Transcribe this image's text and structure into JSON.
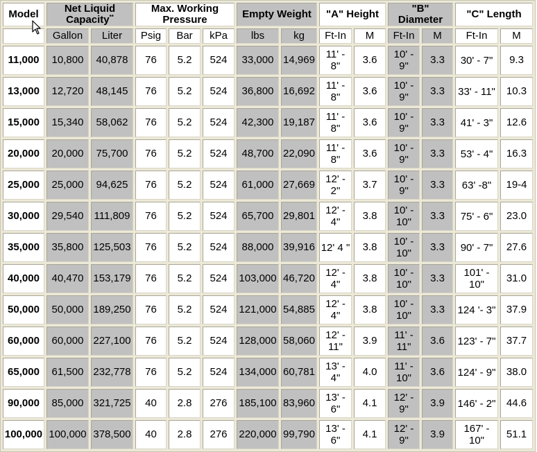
{
  "header": {
    "model": "Model",
    "net_liquid_capacity": "Net Liquid Capacity",
    "net_liquid_capacity_note": "**",
    "max_working_pressure": "Max. Working Pressure",
    "empty_weight": "Empty Weight",
    "a_height": "\"A\" Height",
    "b_diameter": "\"B\" Diameter",
    "c_length": "\"C\" Length"
  },
  "subheader": {
    "gallon": "Gallon",
    "liter": "Liter",
    "psig": "Psig",
    "bar": "Bar",
    "kpa": "kPa",
    "lbs": "lbs",
    "kg": "kg",
    "a_ftin": "Ft-In",
    "a_m": "M",
    "b_ftin": "Ft-In",
    "b_m": "M",
    "c_ftin": "Ft-In",
    "c_m": "M"
  },
  "rows": [
    {
      "model": "11,000",
      "gallon": "10,800",
      "liter": "40,878",
      "psig": "76",
      "bar": "5.2",
      "kpa": "524",
      "lbs": "33,000",
      "kg": "14,969",
      "a_ftin": "11' - 8\"",
      "a_m": "3.6",
      "b_ftin": "10' - 9\"",
      "b_m": "3.3",
      "c_ftin": "30' - 7\"",
      "c_m": "9.3"
    },
    {
      "model": "13,000",
      "gallon": "12,720",
      "liter": "48,145",
      "psig": "76",
      "bar": "5.2",
      "kpa": "524",
      "lbs": "36,800",
      "kg": "16,692",
      "a_ftin": "11' - 8\"",
      "a_m": "3.6",
      "b_ftin": "10' - 9\"",
      "b_m": "3.3",
      "c_ftin": "33' - 11\"",
      "c_m": "10.3"
    },
    {
      "model": "15,000",
      "gallon": "15,340",
      "liter": "58,062",
      "psig": "76",
      "bar": "5.2",
      "kpa": "524",
      "lbs": "42,300",
      "kg": "19,187",
      "a_ftin": "11' - 8\"",
      "a_m": "3.6",
      "b_ftin": "10' - 9\"",
      "b_m": "3.3",
      "c_ftin": "41' - 3\"",
      "c_m": "12.6"
    },
    {
      "model": "20,000",
      "gallon": "20,000",
      "liter": "75,700",
      "psig": "76",
      "bar": "5.2",
      "kpa": "524",
      "lbs": "48,700",
      "kg": "22,090",
      "a_ftin": "11' - 8\"",
      "a_m": "3.6",
      "b_ftin": "10' - 9\"",
      "b_m": "3.3",
      "c_ftin": "53' - 4\"",
      "c_m": "16.3"
    },
    {
      "model": "25,000",
      "gallon": "25,000",
      "liter": "94,625",
      "psig": "76",
      "bar": "5.2",
      "kpa": "524",
      "lbs": "61,000",
      "kg": "27,669",
      "a_ftin": "12' - 2\"",
      "a_m": "3.7",
      "b_ftin": "10' - 9\"",
      "b_m": "3.3",
      "c_ftin": "63' -8\"",
      "c_m": "19-4"
    },
    {
      "model": "30,000",
      "gallon": "29,540",
      "liter": "111,809",
      "psig": "76",
      "bar": "5.2",
      "kpa": "524",
      "lbs": "65,700",
      "kg": "29,801",
      "a_ftin": "12' - 4\"",
      "a_m": "3.8",
      "b_ftin": "10' - 10\"",
      "b_m": "3.3",
      "c_ftin": "75' - 6\"",
      "c_m": "23.0"
    },
    {
      "model": "35,000",
      "gallon": "35,800",
      "liter": "125,503",
      "psig": "76",
      "bar": "5.2",
      "kpa": "524",
      "lbs": "88,000",
      "kg": "39,916",
      "a_ftin": "12' 4 \"",
      "a_m": "3.8",
      "b_ftin": "10' - 10\"",
      "b_m": "3.3",
      "c_ftin": "90' - 7\"",
      "c_m": "27.6"
    },
    {
      "model": "40,000",
      "gallon": "40,470",
      "liter": "153,179",
      "psig": "76",
      "bar": "5.2",
      "kpa": "524",
      "lbs": "103,000",
      "kg": "46,720",
      "a_ftin": "12' - 4\"",
      "a_m": "3.8",
      "b_ftin": "10' - 10\"",
      "b_m": "3.3",
      "c_ftin": "101' - 10\"",
      "c_m": "31.0"
    },
    {
      "model": "50,000",
      "gallon": "50,000",
      "liter": "189,250",
      "psig": "76",
      "bar": "5.2",
      "kpa": "524",
      "lbs": "121,000",
      "kg": "54,885",
      "a_ftin": "12' - 4\"",
      "a_m": "3.8",
      "b_ftin": "10' - 10\"",
      "b_m": "3.3",
      "c_ftin": "124 '- 3\"",
      "c_m": "37.9"
    },
    {
      "model": "60,000",
      "gallon": "60,000",
      "liter": "227,100",
      "psig": "76",
      "bar": "5.2",
      "kpa": "524",
      "lbs": "128,000",
      "kg": "58,060",
      "a_ftin": "12' - 11\"",
      "a_m": "3.9",
      "b_ftin": "11' - 11\"",
      "b_m": "3.6",
      "c_ftin": "123' - 7\"",
      "c_m": "37.7"
    },
    {
      "model": "65,000",
      "gallon": "61,500",
      "liter": "232,778",
      "psig": "76",
      "bar": "5.2",
      "kpa": "524",
      "lbs": "134,000",
      "kg": "60,781",
      "a_ftin": "13' - 4\"",
      "a_m": "4.0",
      "b_ftin": "11' - 10\"",
      "b_m": "3.6",
      "c_ftin": "124' - 9\"",
      "c_m": "38.0"
    },
    {
      "model": "90,000",
      "gallon": "85,000",
      "liter": "321,725",
      "psig": "40",
      "bar": "2.8",
      "kpa": "276",
      "lbs": "185,100",
      "kg": "83,960",
      "a_ftin": "13' - 6\"",
      "a_m": "4.1",
      "b_ftin": "12' - 9\"",
      "b_m": "3.9",
      "c_ftin": "146' - 2\"",
      "c_m": "44.6"
    },
    {
      "model": "100,000",
      "gallon": "100,000",
      "liter": "378,500",
      "psig": "40",
      "bar": "2.8",
      "kpa": "276",
      "lbs": "220,000",
      "kg": "99,790",
      "a_ftin": "13' - 6\"",
      "a_m": "4.1",
      "b_ftin": "12' - 9\"",
      "b_m": "3.9",
      "c_ftin": "167' - 10\"",
      "c_m": "51.1"
    }
  ],
  "colors": {
    "header_text": "#00007a",
    "shaded_cell": "#c0c0c0",
    "white_cell": "#ffffff",
    "grid_background": "#ece9d8"
  },
  "cursor": "arrow-pointer"
}
